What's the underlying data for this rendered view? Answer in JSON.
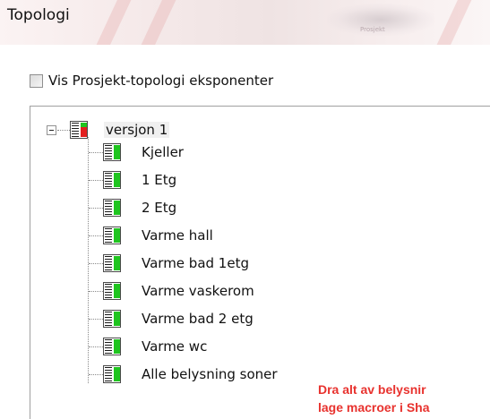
{
  "panel": {
    "title": "Topologi"
  },
  "header_decor": {
    "banner_text": "Prosjekt"
  },
  "checkbox": {
    "label": "Vis Prosjekt-topologi eksponenter",
    "checked": false
  },
  "tree": {
    "root": {
      "label": "versjon 1",
      "expanded": true,
      "icon": "status-red-icon"
    },
    "children": [
      {
        "label": "Kjeller",
        "icon": "status-green-icon"
      },
      {
        "label": "1 Etg",
        "icon": "status-green-icon"
      },
      {
        "label": "2 Etg",
        "icon": "status-green-icon"
      },
      {
        "label": "Varme hall",
        "icon": "status-green-icon"
      },
      {
        "label": "Varme bad 1etg",
        "icon": "status-green-icon"
      },
      {
        "label": "Varme vaskerom",
        "icon": "status-green-icon"
      },
      {
        "label": "Varme bad 2 etg",
        "icon": "status-green-icon"
      },
      {
        "label": "Varme wc",
        "icon": "status-green-icon"
      },
      {
        "label": "Alle belysning soner",
        "icon": "status-green-icon"
      }
    ]
  },
  "annotation": {
    "line1": "Dra alt av belysnir",
    "line2": "lage macroer i Sha"
  },
  "colors": {
    "annotation": "#e8322e",
    "status_green": "#1fc51f",
    "status_red": "#e22020"
  }
}
